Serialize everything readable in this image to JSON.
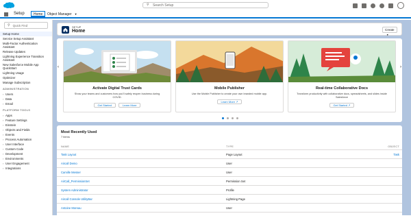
{
  "header": {
    "search_placeholder": "Search Setup"
  },
  "context": {
    "app_name": "Setup",
    "tabs": [
      {
        "label": "Home"
      },
      {
        "label": "Object Manager"
      }
    ]
  },
  "sidebar": {
    "quick_find_placeholder": "Quick Find",
    "top_items": [
      {
        "label": "Setup Home",
        "active": true
      },
      {
        "label": "Service Setup Assistant"
      },
      {
        "label": "Multi-Factor Authentication Assistant"
      },
      {
        "label": "Release Updates"
      },
      {
        "label": "Lightning Experience Transition Assistant"
      },
      {
        "label": "New Salesforce Mobile App QuickStart"
      },
      {
        "label": "Lightning Usage"
      },
      {
        "label": "Optimizer"
      },
      {
        "label": "Manage Subscription"
      }
    ],
    "section_admin": "ADMINISTRATION",
    "admin_items": [
      {
        "label": "Users"
      },
      {
        "label": "Data"
      },
      {
        "label": "Email"
      }
    ],
    "section_platform": "PLATFORM TOOLS",
    "platform_items": [
      {
        "label": "Apps"
      },
      {
        "label": "Feature Settings"
      },
      {
        "label": "Einstein"
      },
      {
        "label": "Objects and Fields"
      },
      {
        "label": "Events"
      },
      {
        "label": "Process Automation"
      },
      {
        "label": "User Interface"
      },
      {
        "label": "Custom Code"
      },
      {
        "label": "Development"
      },
      {
        "label": "Environments"
      },
      {
        "label": "User Engagement"
      },
      {
        "label": "Integrations"
      }
    ]
  },
  "page": {
    "eyebrow": "SETUP",
    "title": "Home",
    "create_label": "Create"
  },
  "cards": [
    {
      "title": "Activate Digital Trust Cards",
      "desc": "Show your teams and customers how you'll safely reopen business during COVID.",
      "btn1": "Get Started",
      "btn2": "Learn More"
    },
    {
      "title": "Mobile Publisher",
      "desc": "Use the Mobile Publisher to create your own branded mobile app.",
      "btn1": "Learn More"
    },
    {
      "title": "Real-time Collaborative Docs",
      "desc": "Transform productivity with collaborative docs, spreadsheets, and slides inside Salesforce",
      "btn1": "Get Started"
    }
  ],
  "carousel": {
    "active_dot": 1,
    "dot_count": 4
  },
  "mru": {
    "title": "Most Recently Used",
    "count": "7 items",
    "columns": {
      "name": "NAME",
      "type": "TYPE",
      "object": "OBJECT"
    },
    "rows": [
      {
        "name": "Task Layout",
        "type": "Page Layout",
        "object": "Task"
      },
      {
        "name": "Aircall Demo",
        "type": "User",
        "object": ""
      },
      {
        "name": "Camille Messer",
        "type": "User",
        "object": ""
      },
      {
        "name": "AirCall_PermissionSet",
        "type": "Permission Set",
        "object": ""
      },
      {
        "name": "System Administrator",
        "type": "Profile",
        "object": ""
      },
      {
        "name": "Aircall Console UtilityBar",
        "type": "Lightning Page",
        "object": ""
      },
      {
        "name": "Antoine Moreau",
        "type": "User",
        "object": ""
      }
    ]
  },
  "colors": {
    "brand": "#0176d3",
    "background": "#b0c4df",
    "icon_dark": "#032d60"
  }
}
